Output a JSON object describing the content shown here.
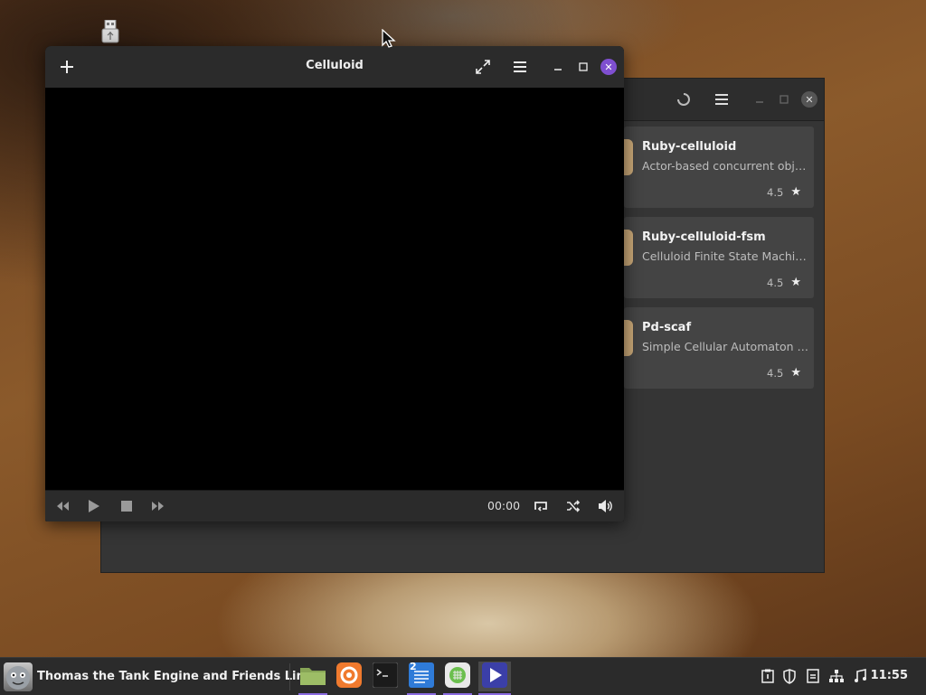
{
  "desktop": {
    "icon": "usb-drive-icon"
  },
  "software_window": {
    "header_icons": [
      "spinner-icon",
      "hamburger-menu-icon",
      "minimize-icon",
      "maximize-icon",
      "close-icon"
    ],
    "apps": [
      {
        "name": "Ruby-celluloid",
        "description": "Actor-based concurrent object ...",
        "rating": "4.5"
      },
      {
        "name": "Ruby-celluloid-fsm",
        "description": "Celluloid Finite State Machines",
        "rating": "4.5"
      },
      {
        "name": "Pd-scaf",
        "description": "Simple Cellular Automaton Fort...",
        "rating": "4.5"
      }
    ]
  },
  "celluloid": {
    "title": "Celluloid",
    "header_icons": [
      "add-icon",
      "fullscreen-icon",
      "hamburger-menu-icon",
      "minimize-icon",
      "maximize-icon",
      "close-icon"
    ],
    "controls": {
      "time": "00:00",
      "icons": [
        "rewind-icon",
        "play-icon",
        "stop-icon",
        "fast-forward-icon",
        "loop-icon",
        "shuffle-icon",
        "volume-icon"
      ]
    }
  },
  "taskbar": {
    "menu_label": "Thomas the Tank Engine and Friends Linux",
    "launchers": [
      "files-icon",
      "firefox-icon",
      "terminal-icon",
      "text-editor-icon",
      "software-center-icon",
      "celluloid-icon"
    ],
    "text_editor_badge": "2",
    "tray_icons": [
      "clipboard-icon",
      "shield-icon",
      "notes-icon",
      "network-icon",
      "music-icon"
    ],
    "clock": "11:55"
  },
  "colors": {
    "accent": "#7f4fd0",
    "panel": "#2b2b2b",
    "window_bg": "#353535"
  }
}
